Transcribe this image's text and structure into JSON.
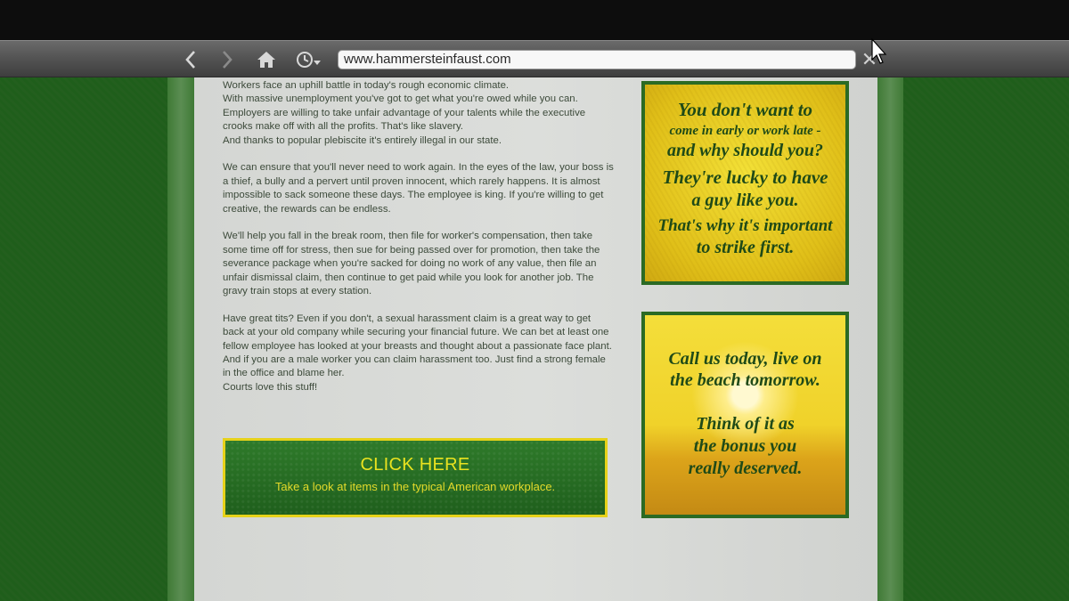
{
  "browser": {
    "back_icon": "‹",
    "forward_icon": "›",
    "url": "www.hammersteinfaust.com",
    "close_icon": "✕"
  },
  "article": {
    "paragraphs": [
      "Workers face an uphill battle in today's rough economic climate.\nWith massive unemployment you've got to get what you're owed while you can. Employers are willing to take unfair advantage of your talents while the executive crooks make off with all the profits. That's like slavery.\nAnd thanks to popular plebiscite it's entirely illegal in our state.",
      "We can ensure that you'll never need to work again. In the eyes of the law, your boss is a thief, a bully and a pervert until proven innocent, which rarely happens. It is almost impossible to sack someone these days. The employee is king. If you're willing to get creative, the rewards can be endless.",
      "We'll help you fall in the break room, then file for worker's compensation, then take some time off for stress, then sue for being passed over for promotion, then take the severance package when you're sacked for doing no work of any value, then file an unfair dismissal claim, then continue to get paid while you look for another job. The gravy train stops at every station.",
      "Have great tits? Even if you don't, a sexual harassment claim is a great way to get back at your old company while securing your financial future. We can bet at least one fellow employee has looked at your breasts and thought about  a passionate face plant. And if you are a male worker you can claim harassment too. Just find a strong female in the office and blame her.\nCourts love this stuff!"
    ]
  },
  "cta": {
    "title": "CLICK HERE",
    "subtitle": "Take a look at items in the typical American workplace."
  },
  "ad1": {
    "lines": [
      "You don't want to",
      "come in early or work late -",
      "and why should you?",
      "They're lucky to have",
      "a guy like you.",
      "That's why it's important",
      "to strike first."
    ]
  },
  "ad2": {
    "lines": [
      "Call us today, live on",
      "the beach tomorrow.",
      "Think of it as",
      "the bonus you",
      "really deserved."
    ]
  },
  "colors": {
    "background_green": "#1e5a1a",
    "accent_yellow": "#e9e21f",
    "ad_border": "#2b6a24"
  }
}
